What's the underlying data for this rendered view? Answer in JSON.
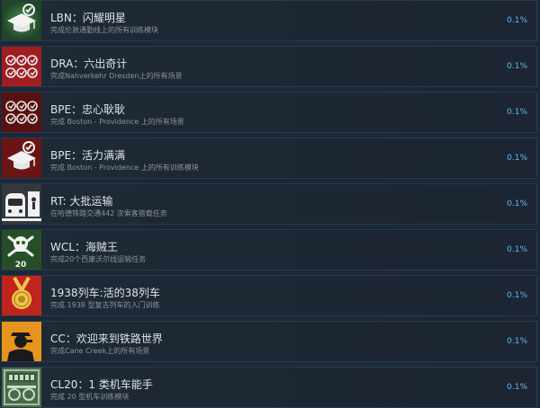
{
  "achievements": [
    {
      "title": "LBN：闪耀明星",
      "description": "完成伦敦通勤线上的所有训练模块",
      "percent": "0.1%",
      "icon": "graduation-cap-icon",
      "color": "#2f6b3c"
    },
    {
      "title": "DRA：六出奇计",
      "description": "完成Nahverkehr Dresden上的所有场景",
      "percent": "0.1%",
      "icon": "six-targets-icon",
      "color": "#a01d22"
    },
    {
      "title": "BPE：忠心耿耿",
      "description": "完成 Boston - Providence 上的所有场景",
      "percent": "0.1%",
      "icon": "six-targets-icon",
      "color": "#5a1212"
    },
    {
      "title": "BPE：活力满满",
      "description": "完成 Boston - Providence 上的所有训练模块",
      "percent": "0.1%",
      "icon": "graduation-cap-icon",
      "color": "#6b1414"
    },
    {
      "title": "RT: 大批运输",
      "description": "在哈德铁路交通442 次乘客搭载任务",
      "percent": "0.1%",
      "icon": "train-front-icon",
      "color": "#2a2e33"
    },
    {
      "title": "WCL：海贼王",
      "description": "完成20个西康沃尔线运输任务",
      "percent": "0.1%",
      "icon": "skull-crossbones-icon",
      "color": "#2e5a2e",
      "badge": "20"
    },
    {
      "title": "1938列车:活的38列车",
      "description": "完成 1938 型复古列车的入门训练",
      "percent": "0.1%",
      "icon": "medal-icon",
      "color": "#c0241f"
    },
    {
      "title": "CC：欢迎来到铁路世界",
      "description": "完成Cane Creek上的所有场景",
      "percent": "0.1%",
      "icon": "conductor-icon",
      "color": "#e08a16"
    },
    {
      "title": "CL20：1 类机车能手",
      "description": "完成 20 型机车训练模块",
      "percent": "0.1%",
      "icon": "locomotive-plate-icon",
      "color": "#4a6b4a"
    }
  ]
}
